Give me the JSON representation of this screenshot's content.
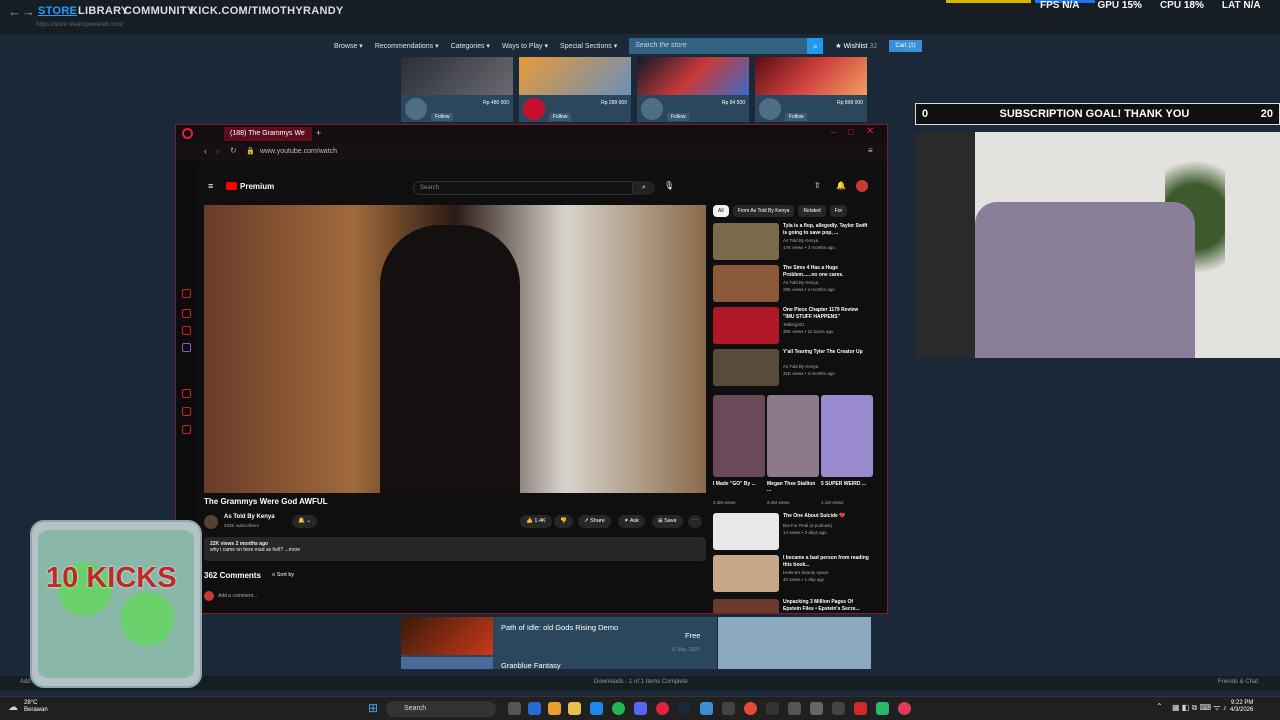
{
  "steam": {
    "tabs": [
      "STORE",
      "LIBRARY",
      "COMMUNITY",
      "KICK.COM/TIMOTHYRANDY"
    ],
    "url": "https://store.steampowered.com/",
    "nav": [
      "Browse ▾",
      "Recommendations ▾",
      "Categories ▾",
      "Ways to Play ▾",
      "Special Sections ▾"
    ],
    "search_placeholder": "Search the store",
    "wishlist": "Wishlist",
    "wishlist_count": "32",
    "cart": "Cart (1)",
    "tiles": [
      {
        "price": "Rp 480 000",
        "follow": "Follow",
        "color": "#3b3a3f"
      },
      {
        "price": "Rp 289 000",
        "follow": "Follow",
        "color": "#6b8fb8"
      },
      {
        "price": "Rp 84 500",
        "follow": "Follow",
        "color": "#1d2a40"
      },
      {
        "price": "Rp 899 000",
        "follow": "Follow",
        "color": "#8a1f1f"
      }
    ],
    "games": [
      {
        "name": "Path of Idle: old Gods Rising Demo",
        "price": "Free",
        "date": "11 Mar, 2026"
      },
      {
        "name": "Granblue Fantasy"
      }
    ],
    "status_left": "Add a Game",
    "status_center": "Downloads - 1 of 1 Items Complete",
    "status_right": "Friends & Chat"
  },
  "perf": {
    "fps_label": "FPS",
    "fps_value": "N/A",
    "gpu_label": "GPU",
    "gpu_value": "15%",
    "cpu_label": "CPU",
    "cpu_value": "18%",
    "lat_label": "LAT",
    "lat_value": "N/A"
  },
  "overlay": {
    "goal_left": "0",
    "goal_text": "SUBSCRIPTION GOAL! THANK YOU",
    "goal_right": "20",
    "jar_text": "10 KICKS"
  },
  "browser": {
    "tab_title": "(188) The Grammys We",
    "url": "www.youtube.com/watch"
  },
  "youtube": {
    "logo": "Premium",
    "search_placeholder": "Search",
    "video_title": "The Grammys Were God AWFUL",
    "channel_name": "As Told By Kenya",
    "subscribers": "233K subscribers",
    "likes": "1.4K",
    "share": "Share",
    "ask": "Ask",
    "save": "Save",
    "desc_line1": "22K views  2 months ago",
    "desc_line2": "why i came on here mad as hell? ...more",
    "comments_count": "362 Comments",
    "sort_by": "Sort by",
    "add_comment": "Add a comment...",
    "chips": [
      "All",
      "From As Told By Kenya",
      "Related",
      "For"
    ],
    "recs": [
      {
        "title": "Tyla is a flop, allegedly. Taylor Swift is going to save pop, ...",
        "channel": "As Told By Kenya",
        "meta": "17K views • 3 months ago",
        "color": "#7a6a4a"
      },
      {
        "title": "The Sims 4 Has a Huge Problem......no one cares.",
        "channel": "As Told By Kenya",
        "meta": "28K views • 4 months ago",
        "color": "#8a5a3a"
      },
      {
        "title": "One Piece Chapter 1179 Review \"IMU STUFF HAPPENS\"",
        "channel": "Talking101",
        "meta": "30K views • 11 hours ago",
        "color": "#b01828"
      },
      {
        "title": "Y'all Tearing Tyler The Creator Up",
        "channel": "As Told By Kenya",
        "meta": "31K views • 3 months ago",
        "color": "#5a4a3a"
      },
      {
        "title": "The One About Suicide 💔",
        "channel": "But For Real (a podcast)",
        "meta": "14 views • 2 days ago",
        "color": "#e8e8e8"
      },
      {
        "title": "I became a bad person from reading this book...",
        "channel": "Helena's beauty space",
        "meta": "40 views • 1 day ago",
        "color": "#c8a88a"
      },
      {
        "title": "Unpacking 3 Million Pages Of Epstein Files • Epstein's Secre...",
        "channel": "",
        "meta": "",
        "color": "#6a3a2a"
      }
    ],
    "shorts": [
      {
        "title": "I Made \"GO\" By ...",
        "meta": "3.3M views",
        "color": "#6a4a5a"
      },
      {
        "title": "Megan Thee Stallion ...",
        "meta": "2.2M views",
        "color": "#8a7a8a"
      },
      {
        "title": "5 SUPER WEIRD ...",
        "meta": "1.1M views",
        "color": "#9a8ad0"
      }
    ]
  },
  "taskbar": {
    "temp": "28°C",
    "weather": "Berawan",
    "search": "Search",
    "time": "9:22 PM",
    "date": "4/3/2026"
  }
}
